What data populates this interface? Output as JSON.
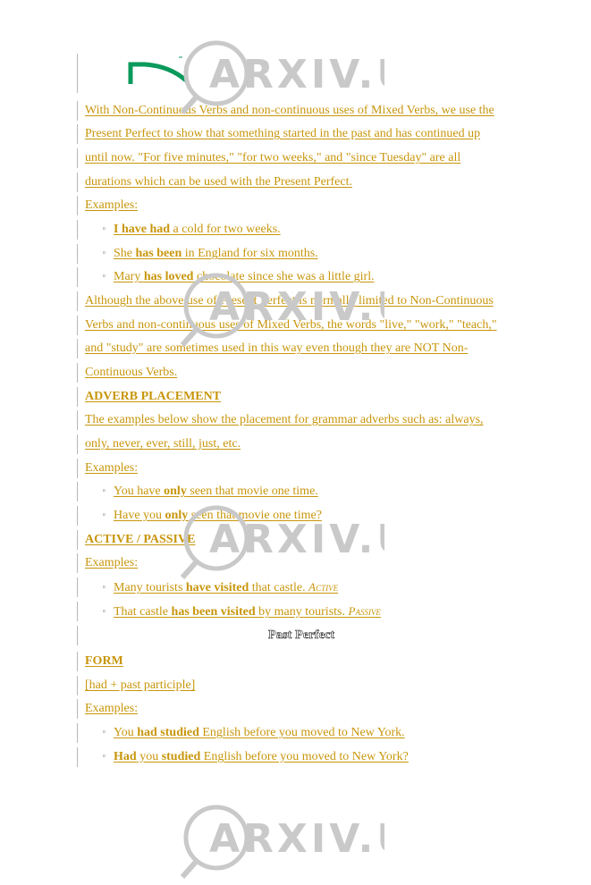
{
  "watermark": "ARXIV.UZ",
  "colors": {
    "text": "#c8960c",
    "logo": "#0a9a5c",
    "watermark": "#c9c9c9",
    "margin_bar": "#b8b8b8"
  },
  "logo": {
    "icon": "green-arc-logo-icon"
  },
  "paragraph1": [
    "With Non-Continuous Verbs and non-continuous uses of Mixed Verbs, we use the ",
    "Present Perfect to show that something started in the past and has continued up ",
    "until now. \"For five minutes,\" \"for two weeks,\" and \"since Tuesday\" are all ",
    "durations which can be used with the Present Perfect."
  ],
  "examples_label": "Examples:",
  "examples1": [
    {
      "pre": "",
      "bold": "I have had",
      "post": " a cold for two weeks."
    },
    {
      "pre": "She ",
      "bold": "has been",
      "post": " in England for six months."
    },
    {
      "pre": "Mary ",
      "bold": "has loved",
      "post": " chocolate since she was a little girl."
    }
  ],
  "paragraph2": [
    "Although the above use of Present Perfect is normally limited to Non-Continuous ",
    "Verbs and non-continuous uses of Mixed Verbs, the words \"live,\" \"work,\" \"teach,\" ",
    "and \"study\" are sometimes used in this way even though they are NOT Non-",
    "Continuous Verbs."
  ],
  "adverb_heading": "ADVERB PLACEMENT",
  "paragraph3": [
    "The examples below show the placement for grammar adverbs such as: always, ",
    "only, never, ever, still, just, etc."
  ],
  "examples2": [
    {
      "pre": "You have ",
      "bold": "only",
      "post": " seen that movie one time."
    },
    {
      "pre": "Have you ",
      "bold": "only",
      "post": " seen that movie one time?"
    }
  ],
  "active_passive_heading": "ACTIVE / PASSIVE",
  "examples3": [
    {
      "pre": "Many tourists ",
      "bold": "have visited",
      "post": " that castle. ",
      "tag": "Active"
    },
    {
      "pre": "That castle ",
      "bold": "has been visited",
      "post": " by many tourists. ",
      "tag": "Passive"
    }
  ],
  "past_perfect_title": "Past Perfect",
  "form_heading": "FORM",
  "form_text": "[had + past participle]",
  "examples4": [
    {
      "pre": "You ",
      "bold": "had studied",
      "post": " English before you moved to New York.",
      "bold_first": ""
    },
    {
      "bold_first": "Had",
      "pre": " you ",
      "bold": "studied",
      "post": " English before you moved to New York?"
    }
  ],
  "bullet_glyph": "◦"
}
